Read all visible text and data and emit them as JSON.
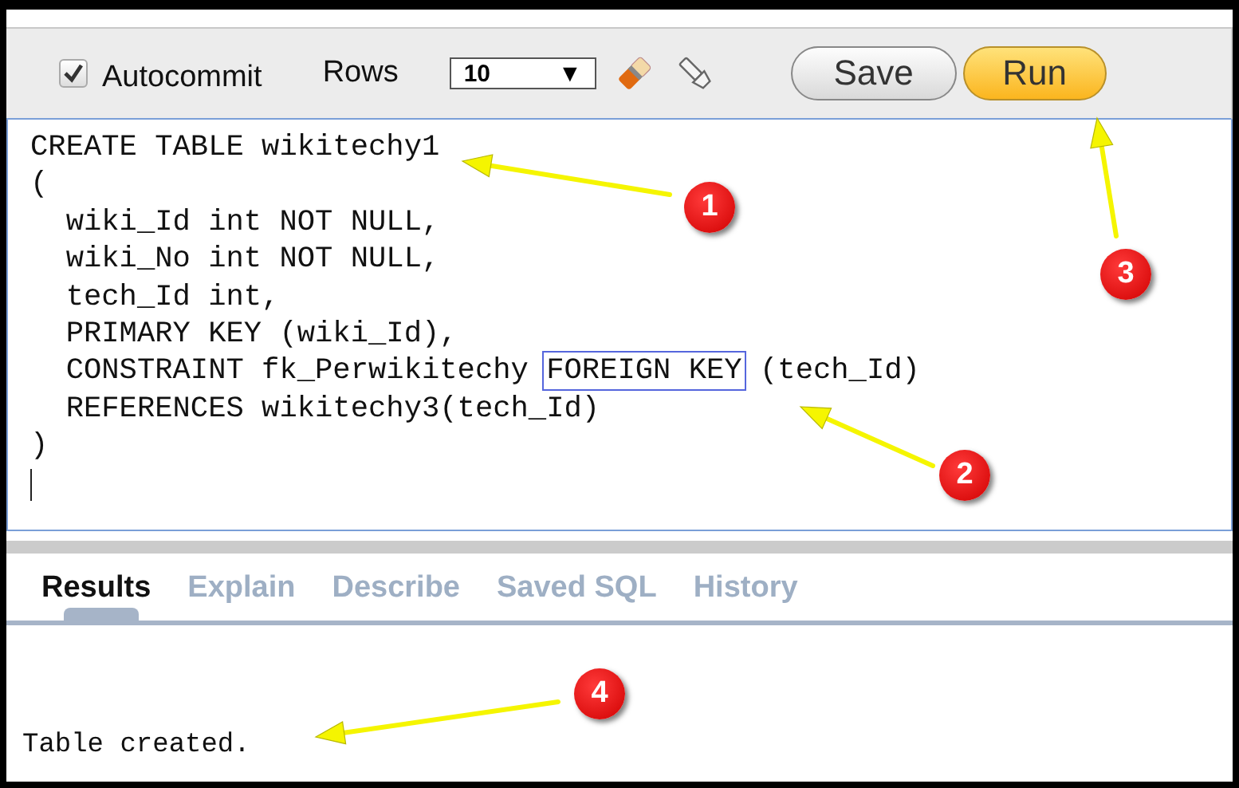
{
  "toolbar": {
    "autocommit": {
      "label": "Autocommit",
      "checked": true
    },
    "rows_label": "Rows",
    "rows_value": "10",
    "dropdown_glyph": "▼",
    "buttons": [
      {
        "label": "Save",
        "kind": "plain"
      },
      {
        "label": "Run",
        "kind": "primary"
      }
    ]
  },
  "editor": {
    "lines": [
      [
        {
          "text": "CREATE TABLE wikitechy1"
        }
      ],
      [
        {
          "text": "("
        }
      ],
      [
        {
          "text": "  wiki_Id int NOT NULL,"
        }
      ],
      [
        {
          "text": "  wiki_No int NOT NULL,"
        }
      ],
      [
        {
          "text": "  tech_Id int,"
        }
      ],
      [
        {
          "text": "  PRIMARY KEY (wiki_Id),"
        }
      ],
      [
        {
          "text": "  CONSTRAINT fk_Perwikitechy "
        },
        {
          "text": "FOREIGN KEY",
          "boxed": true
        },
        {
          "text": " (tech_Id)"
        }
      ],
      [
        {
          "text": "  REFERENCES wikitechy3(tech_Id)"
        }
      ],
      [
        {
          "text": ")"
        }
      ]
    ]
  },
  "tabs": [
    {
      "label": "Results",
      "selected": true
    },
    {
      "label": "Explain",
      "selected": false
    },
    {
      "label": "Describe",
      "selected": false
    },
    {
      "label": "Saved SQL",
      "selected": false
    },
    {
      "label": "History",
      "selected": false
    }
  ],
  "result": "Table created.",
  "annotations": [
    {
      "label": "1"
    },
    {
      "label": "2"
    },
    {
      "label": "3"
    },
    {
      "label": "4"
    }
  ]
}
